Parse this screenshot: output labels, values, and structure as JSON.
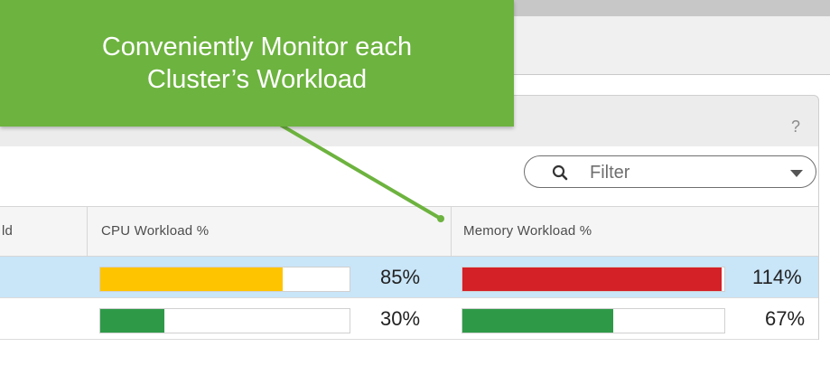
{
  "callout": {
    "line1": "Conveniently Monitor each",
    "line2": "Cluster’s Workload",
    "color": "#6db33f"
  },
  "panel": {
    "help_label": "?"
  },
  "filter": {
    "label": "Filter",
    "search_icon": "search-icon",
    "dropdown_icon": "chevron-down-icon"
  },
  "table": {
    "columns": [
      "ld",
      "CPU Workload %",
      "Memory Workload %"
    ],
    "rows": [
      {
        "selected": true,
        "cpu": {
          "percent": 85,
          "label": "85%",
          "color": "#ffc400"
        },
        "memory": {
          "percent": 114,
          "label": "114%",
          "color": "#d42027"
        }
      },
      {
        "selected": false,
        "cpu": {
          "percent": 30,
          "label": "30%",
          "color": "#2e9a48"
        },
        "memory": {
          "percent": 67,
          "label": "67%",
          "color": "#2e9a48"
        }
      }
    ]
  }
}
